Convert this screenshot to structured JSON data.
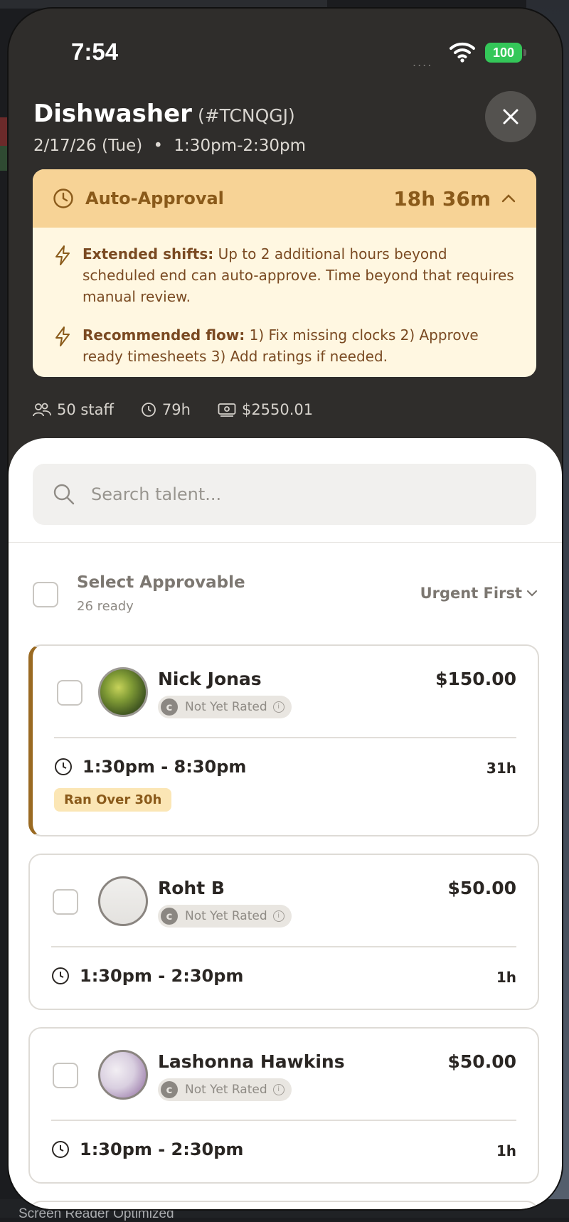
{
  "background": {
    "bottom_text": "Screen Reader Optimized"
  },
  "status_bar": {
    "time": "7:54",
    "signal": "....",
    "battery": "100"
  },
  "header": {
    "title": "Dishwasher",
    "code": "(#TCNQGJ)",
    "date": "2/17/26 (Tue)",
    "separator": "•",
    "time_range": "1:30pm-2:30pm",
    "close_icon": "close-icon"
  },
  "auto_approval": {
    "label": "Auto-Approval",
    "timer": "18h 36m",
    "notes": [
      {
        "title": "Extended shifts:",
        "text": " Up to 2 additional hours beyond scheduled end can auto-approve. Time beyond that requires manual review."
      },
      {
        "title": "Recommended flow:",
        "text": " 1) Fix missing clocks 2) Approve ready timesheets 3) Add ratings if needed."
      }
    ]
  },
  "stats": {
    "staff": "50 staff",
    "hours": "79h",
    "cost": "$2550.01"
  },
  "search": {
    "placeholder": "Search talent..."
  },
  "select": {
    "title": "Select Approvable",
    "subtitle": "26 ready",
    "sort": "Urgent First"
  },
  "cards": [
    {
      "name": "Nick Jonas",
      "rating": "Not Yet Rated",
      "amount": "$150.00",
      "time": "1:30pm - 8:30pm",
      "hours": "31h",
      "badge": "Ran Over 30h"
    },
    {
      "name": "Roht B",
      "rating": "Not Yet Rated",
      "amount": "$50.00",
      "time": "1:30pm - 2:30pm",
      "hours": "1h"
    },
    {
      "name": "Lashonna Hawkins",
      "rating": "Not Yet Rated",
      "amount": "$50.00",
      "time": "1:30pm - 2:30pm",
      "hours": "1h"
    }
  ],
  "colors": {
    "accent": "#8a5a1a",
    "banner": "#f7d396",
    "banner_body": "#fff7e1",
    "dark_bg": "#2f2d2b",
    "battery": "#34c759"
  }
}
